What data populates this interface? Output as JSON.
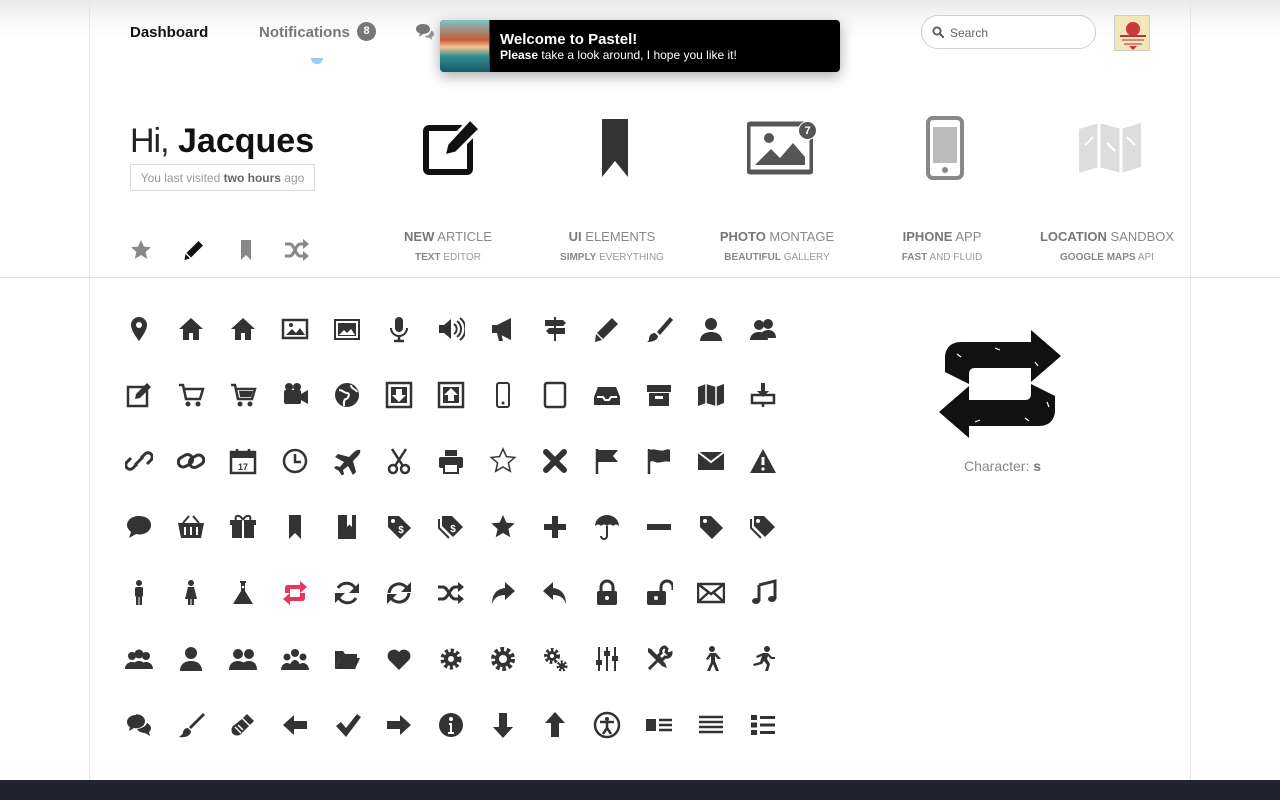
{
  "nav": {
    "dashboard": "Dashboard",
    "notifications": "Notifications",
    "notifications_count": "8"
  },
  "toast": {
    "title": "Welcome to Pastel!",
    "message_bold": "Please",
    "message_rest": " take a look around, I hope you like it!"
  },
  "search": {
    "placeholder": "Search"
  },
  "greeting": {
    "hi": "Hi,",
    "name": "Jacques",
    "last_visited_prefix": "You last visited",
    "last_visited_bold": "two hours",
    "last_visited_suffix": "ago"
  },
  "features": [
    {
      "title_bold": "NEW",
      "title_rest": " ARTICLE",
      "sub_bold": "TEXT",
      "sub_rest": " EDITOR",
      "icon": "compose-icon"
    },
    {
      "title_bold": "UI",
      "title_rest": " ELEMENTS",
      "sub_bold": "SIMPLY",
      "sub_rest": " EVERYTHING",
      "icon": "bookmark-icon"
    },
    {
      "title_bold": "PHOTO",
      "title_rest": " MONTAGE",
      "sub_bold": "BEAUTIFUL",
      "sub_rest": " GALLERY",
      "icon": "picture-icon",
      "badge": "7"
    },
    {
      "title_bold": "IPHONE",
      "title_rest": " APP",
      "sub_bold": "FAST",
      "sub_rest": " AND FLUID",
      "icon": "phone-icon"
    },
    {
      "title_bold": "LOCATION",
      "title_rest": " SANDBOX",
      "sub_bold": "GOOGLE MAPS",
      "sub_rest": " API",
      "icon": "map-icon"
    }
  ],
  "mini_toolbar": [
    "star-icon",
    "pencil-icon",
    "bookmark-icon",
    "shuffle-icon"
  ],
  "preview": {
    "label": "Character:",
    "char": "s",
    "icon": "retweet-icon"
  },
  "colors": {
    "accent": "#e8355a",
    "dark": "#333333",
    "footer": "#1f2430"
  },
  "glyph_rows": [
    [
      "map-pin-icon",
      "home-icon",
      "house-icon",
      "picture-icon",
      "pictures-icon",
      "microphone-icon",
      "volume-icon",
      "megaphone-icon",
      "signpost-icon",
      "pencil-icon",
      "brush-icon",
      "user-icon",
      "users-icon"
    ],
    [
      "compose-icon",
      "cart-icon",
      "cart-full-icon",
      "video-camera-icon",
      "globe-icon",
      "download-box-icon",
      "upload-box-icon",
      "phone-icon",
      "tablet-icon",
      "inbox-icon",
      "archive-icon",
      "map-icon",
      "install-icon"
    ],
    [
      "link-icon",
      "chain-icon",
      "calendar-icon",
      "clock-icon",
      "airplane-icon",
      "scissors-icon",
      "printer-icon",
      "star-outline-icon",
      "close-icon",
      "flag-icon",
      "flag-alt-icon",
      "mail-icon",
      "warning-icon"
    ],
    [
      "chat-icon",
      "basket-icon",
      "gift-box-icon",
      "bookmark-icon",
      "bookmarks-icon",
      "price-tag-icon",
      "price-tags-icon",
      "star-icon",
      "plus-icon",
      "umbrella-icon",
      "minus-icon",
      "tag-icon",
      "tags-icon"
    ],
    [
      "man-icon",
      "woman-icon",
      "flask-icon",
      "retweet-icon",
      "refresh-icon",
      "sync-icon",
      "shuffle-icon",
      "forward-icon",
      "reply-icon",
      "lock-icon",
      "unlock-icon",
      "envelope-icon",
      "music-icon"
    ],
    [
      "group-icon",
      "person-icon",
      "two-people-icon",
      "community-icon",
      "folder-open-icon",
      "heart-icon",
      "gear-icon",
      "cog-icon",
      "cogs-icon",
      "sliders-icon",
      "tools-icon",
      "walking-icon",
      "running-icon"
    ],
    [
      "chats-icon",
      "paintbrush-icon",
      "brush-alt-icon",
      "arrow-left-icon",
      "checkmark-icon",
      "arrow-right-icon",
      "info-icon",
      "arrow-down-icon",
      "arrow-up-icon",
      "accessibility-icon",
      "list-image-icon",
      "align-justify-icon",
      "list-icon"
    ]
  ],
  "char_prefix": "Character: ",
  "char_value": "s",
  "notifications_label": "Notifications"
}
